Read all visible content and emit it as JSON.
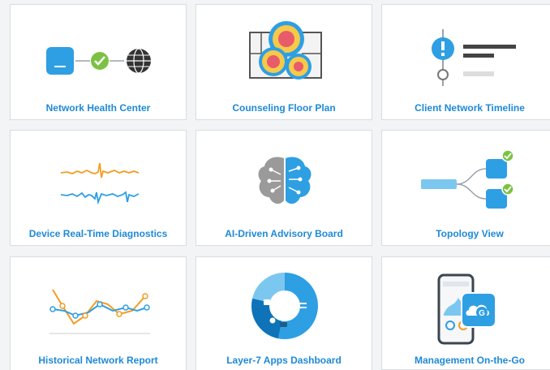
{
  "tiles": [
    {
      "label": "Network Health Center"
    },
    {
      "label": "Counseling Floor Plan"
    },
    {
      "label": "Client Network Timeline"
    },
    {
      "label": "Device Real-Time Diagnostics"
    },
    {
      "label": "AI-Driven Advisory Board"
    },
    {
      "label": "Topology View"
    },
    {
      "label": "Historical Network Report"
    },
    {
      "label": "Layer-7 Apps Dashboard"
    },
    {
      "label": "Management On-the-Go"
    }
  ],
  "icons": {
    "network_health": "device-check-globe-icon",
    "floor_plan": "floor-plan-heatmap-icon",
    "timeline": "alert-timeline-icon",
    "diagnostics": "waveform-icon",
    "advisory": "ai-brain-icon",
    "topology": "topology-icon",
    "report": "line-graph-icon",
    "apps_dashboard": "donut-chart-icon",
    "mobile": "mobile-app-icon"
  },
  "colors": {
    "accent_blue": "#1e8ad6",
    "icon_blue": "#2e9fe3",
    "check_green": "#7cc242",
    "orange": "#f39c22",
    "dark_gray": "#4a4a4a"
  }
}
